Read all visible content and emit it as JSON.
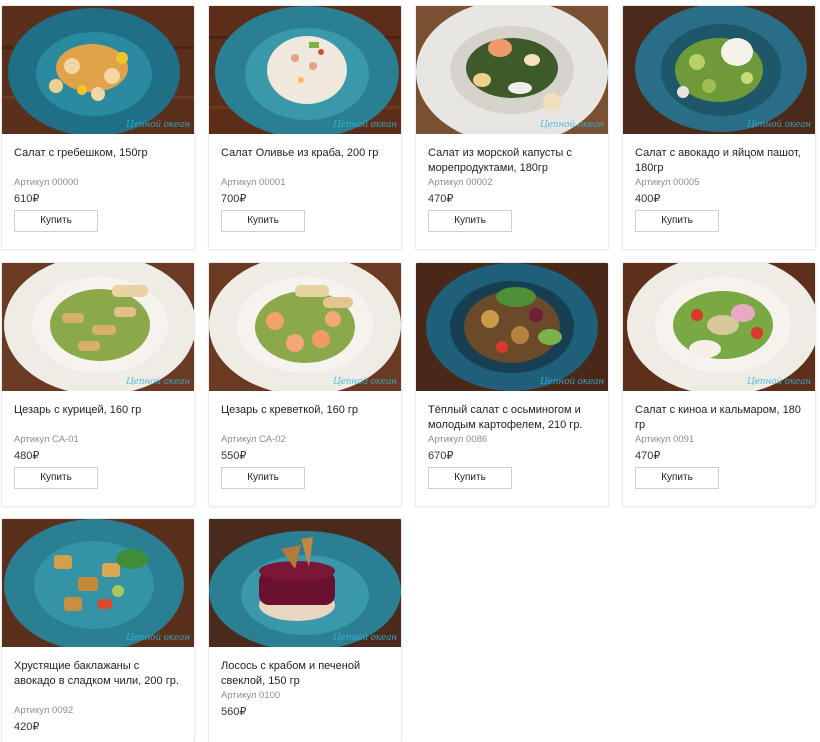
{
  "watermark": "Цепной океан",
  "buy_label": "Купить",
  "products": [
    {
      "title": "Салат с гребешком, 150гр",
      "sku": "Артикул 00000",
      "price": "610₽",
      "image": "scallop-salad-photo",
      "plate": "#1f6f86",
      "wood": "#5a2f1c"
    },
    {
      "title": "Салат Оливье из краба, 200 гр",
      "sku": "Артикул 00001",
      "price": "700₽",
      "image": "olivier-crab-salad-photo",
      "plate": "#2a7f93",
      "wood": "#5c2e1a"
    },
    {
      "title": "Салат из морской капусты с морепродуктами, 180гр",
      "sku": "Артикул 00002",
      "price": "470₽",
      "image": "seaweed-seafood-salad-photo",
      "plate": "#e8e6e2",
      "wood": "#7a5032"
    },
    {
      "title": "Салат с авокадо и яйцом пашот, 180гр",
      "sku": "Артикул 00005",
      "price": "400₽",
      "image": "avocado-poached-egg-salad-photo",
      "plate": "#2a6d86",
      "wood": "#4b2a1a"
    },
    {
      "title": "Цезарь с курицей, 160 гр",
      "sku": "Артикул СА-01",
      "price": "480₽",
      "image": "caesar-chicken-photo",
      "plate": "#efece6",
      "wood": "#6a3a22"
    },
    {
      "title": "Цезарь с креветкой, 160 гр",
      "sku": "Артикул СА-02",
      "price": "550₽",
      "image": "caesar-shrimp-photo",
      "plate": "#efece6",
      "wood": "#6a3a22"
    },
    {
      "title": "Тёплый салат с осьминогом и молодым картофелем, 210 гр.",
      "sku": "Артикул 0086",
      "price": "670₽",
      "image": "octopus-potato-salad-photo",
      "plate": "#1f5f7a",
      "wood": "#4a2818"
    },
    {
      "title": "Салат с киноа и кальмаром, 180 гр",
      "sku": "Артикул 0091",
      "price": "470₽",
      "image": "quinoa-squid-salad-photo",
      "plate": "#efece6",
      "wood": "#5e301c"
    },
    {
      "title": "Хрустящие баклажаны с авокадо в сладком чили, 200 гр.",
      "sku": "Артикул 0092",
      "price": "420₽",
      "image": "crispy-eggplant-salad-photo",
      "plate": "#2a7f93",
      "wood": "#5a2f1c"
    },
    {
      "title": "Лосось с крабом и печеной свеклой, 150 гр",
      "sku": "Артикул 0100",
      "price": "560₽",
      "image": "salmon-crab-beet-photo",
      "plate": "#2a7f93",
      "wood": "#4a2a1c"
    }
  ]
}
